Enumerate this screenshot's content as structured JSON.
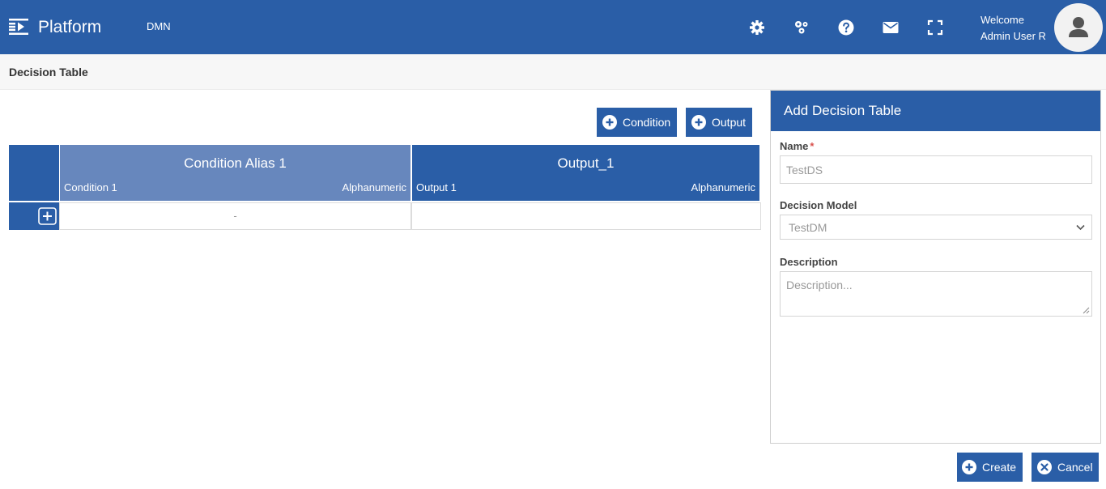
{
  "header": {
    "app_title": "Platform",
    "module": "DMN",
    "icons": [
      "settings-icon",
      "apps-icon",
      "help-icon",
      "mail-icon",
      "fullscreen-icon"
    ],
    "welcome_label": "Welcome",
    "user_name": "Admin User R",
    "accent": "#2a5ea7"
  },
  "page": {
    "title": "Decision Table"
  },
  "toolbar": {
    "condition_label": "Condition",
    "output_label": "Output"
  },
  "table": {
    "columns": [
      {
        "alias": "Condition Alias 1",
        "name": "Condition 1",
        "type": "Alphanumeric",
        "header_color": "#6787bd"
      },
      {
        "alias": "Output_1",
        "name": "Output 1",
        "type": "Alphanumeric",
        "header_color": "#2a5ea7"
      }
    ],
    "rows": [
      {
        "cells": [
          "-",
          ""
        ]
      }
    ]
  },
  "panel": {
    "title": "Add Decision Table",
    "name_label": "Name",
    "required_mark": "*",
    "name_value": "TestDS",
    "model_label": "Decision Model",
    "model_value": "TestDM",
    "description_label": "Description",
    "description_placeholder": "Description..."
  },
  "footer": {
    "create_label": "Create",
    "cancel_label": "Cancel"
  }
}
